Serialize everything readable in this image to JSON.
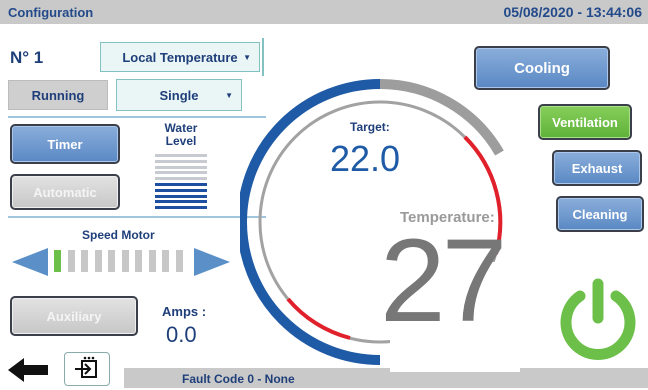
{
  "header": {
    "title": "Configuration",
    "datetime": "05/08/2020 - 13:44:06"
  },
  "unit": {
    "label": "N° 1"
  },
  "mode_select": {
    "value": "Local Temperature"
  },
  "status": {
    "label": "Running"
  },
  "config_select": {
    "value": "Single"
  },
  "buttons": {
    "timer": "Timer",
    "automatic": "Automatic",
    "auxiliary": "Auxiliary",
    "cooling": "Cooling",
    "ventilation": "Ventilation",
    "exhaust": "Exhaust",
    "cleaning": "Cleaning"
  },
  "water_level": {
    "label_line1": "Water",
    "label_line2": "Level",
    "level_fraction": 0.5
  },
  "speed_motor": {
    "label": "Speed Motor",
    "active_segment": 1,
    "total_segments": 10
  },
  "amps": {
    "label": "Amps :",
    "value": "0.0"
  },
  "gauge": {
    "target_label": "Target:",
    "target_value": "22.0",
    "temperature_label": "Temperature:",
    "temperature_value": "27"
  },
  "footer": {
    "fault_text": "Fault Code  0 - None"
  },
  "icons": [
    "back-arrow-icon",
    "exit-icon",
    "power-icon",
    "chevron-down-icon"
  ],
  "colors": {
    "accent_blue": "#1f5aa6",
    "label_blue": "#1f3f7a",
    "alarm_red": "#e0202a",
    "power_green": "#6cc04a",
    "active_green": "#6cc04a",
    "neutral_gray": "#9a9a9a"
  }
}
